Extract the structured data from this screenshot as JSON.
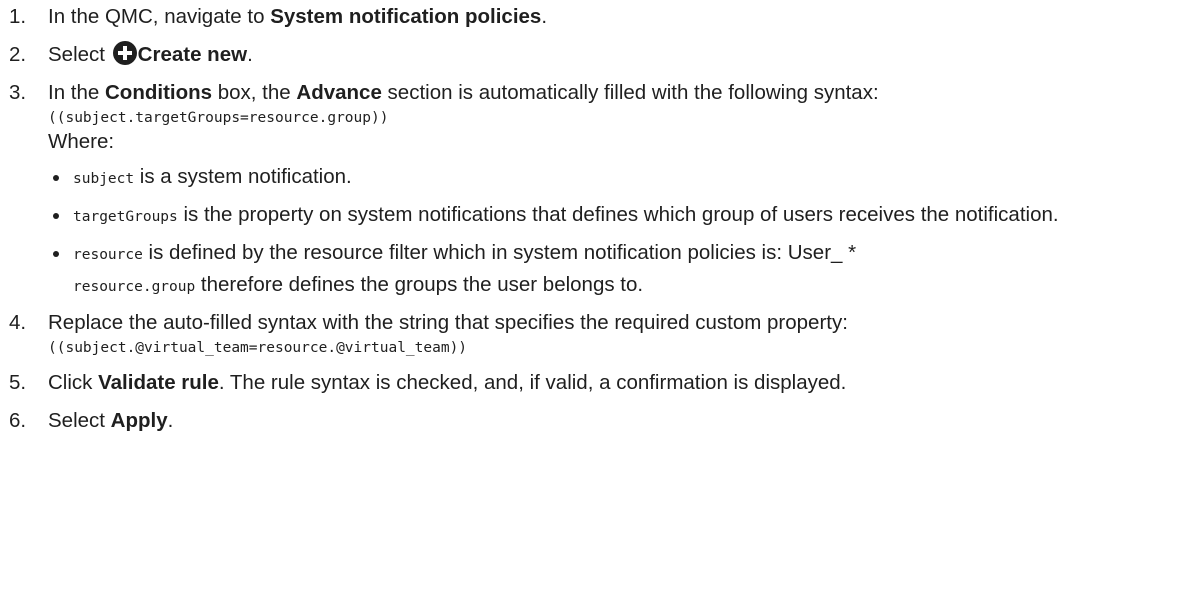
{
  "steps": [
    {
      "number": "1.",
      "text_a": "In the QMC, navigate to ",
      "bold_a": "System notification policies",
      "text_b": "."
    },
    {
      "number": "2.",
      "text_a": "Select ",
      "icon": "plus-circle-icon",
      "bold_a": "Create new",
      "text_b": "."
    },
    {
      "number": "3.",
      "text_a": "In the ",
      "bold_a": "Conditions",
      "text_b": " box, the ",
      "bold_b": "Advance",
      "text_c": " section is automatically filled with the following syntax:",
      "code": "((subject.targetGroups=resource.group))",
      "where": "Where:",
      "bullets": [
        {
          "code": "subject",
          "text": " is a system notification."
        },
        {
          "code": "targetGroups",
          "text": " is the property on system notifications that defines which group of users receives the notification."
        },
        {
          "code": "resource",
          "text": " is defined by the resource filter which in system notification policies is: User_ *"
        }
      ],
      "after_code": "resource.group",
      "after_text": " therefore defines the groups the user belongs to."
    },
    {
      "number": "4.",
      "text_a": "Replace the auto-filled syntax with the string that specifies the required custom property:",
      "code": "((subject.@virtual_team=resource.@virtual_team))"
    },
    {
      "number": "5.",
      "text_a": "Click ",
      "bold_a": "Validate rule",
      "text_b": ". The rule syntax is checked, and, if valid, a confirmation is displayed."
    },
    {
      "number": "6.",
      "text_a": "Select ",
      "bold_a": "Apply",
      "text_b": "."
    }
  ]
}
